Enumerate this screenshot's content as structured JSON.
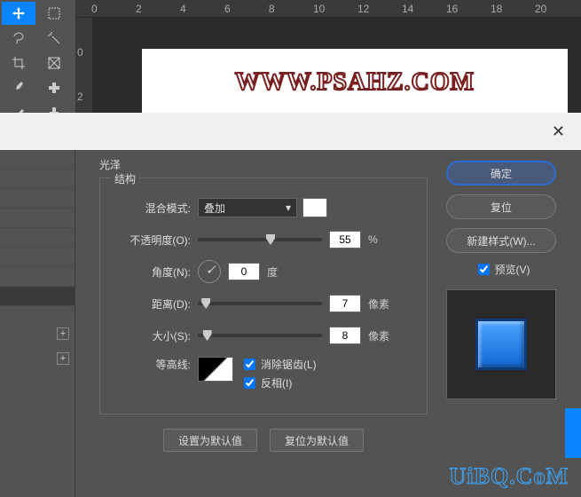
{
  "ruler_h": [
    "0",
    "2",
    "4",
    "6",
    "8",
    "10",
    "12",
    "14",
    "16",
    "18",
    "20"
  ],
  "ruler_v": [
    "0",
    "2"
  ],
  "watermark_canvas": "WWW.PSAHZ.COM",
  "watermark_footer": "UiBQ.CoM",
  "dialog": {
    "close": "✕",
    "section": "光泽",
    "group": "结构",
    "blend_label": "混合模式:",
    "blend_value": "叠加",
    "opacity_label": "不透明度(O):",
    "opacity_value": "55",
    "opacity_unit": "%",
    "angle_label": "角度(N):",
    "angle_value": "0",
    "angle_unit": "度",
    "distance_label": "距离(D):",
    "distance_value": "7",
    "distance_unit": "像素",
    "size_label": "大小(S):",
    "size_value": "8",
    "size_unit": "像素",
    "contour_label": "等高线:",
    "antialias": "消除锯齿(L)",
    "invert": "反相(I)",
    "reset_default": "设置为默认值",
    "revert_default": "复位为默认值"
  },
  "right": {
    "ok": "确定",
    "reset": "复位",
    "new_style": "新建样式(W)...",
    "preview": "预览(V)"
  }
}
